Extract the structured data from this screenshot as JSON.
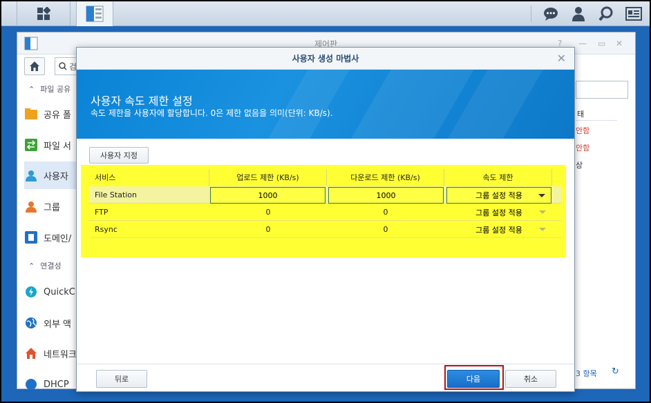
{
  "taskbar": {
    "main_menu_icon": "grid-icon",
    "control_panel_icon": "control-panel-icon",
    "right_icons": [
      "chat-icon",
      "user-icon",
      "search-icon",
      "widgets-icon"
    ]
  },
  "control_panel": {
    "title": "제어판",
    "search_text": "검",
    "sections": [
      {
        "header": "파일 공유",
        "items": [
          "공유 폴",
          "파일 서",
          "사용자",
          "그룹",
          "도메인/"
        ]
      },
      {
        "header": "연결성",
        "items": [
          "QuickC",
          "외부 액",
          "네트워크",
          "DHCP"
        ]
      }
    ],
    "right_column": {
      "header": "태",
      "rows": [
        "안함",
        "안함",
        "상"
      ]
    },
    "footer_count": "3 항목",
    "status_color": "#d63a2f"
  },
  "wizard": {
    "title": "사용자 생성 마법사",
    "heading": "사용자 속도 제한 설정",
    "subheading": "속도 제한을 사용자에 할당합니다. 0은 제한 없음을 의미(단위: KB/s).",
    "custom_button": "사용자 지정",
    "columns": [
      "서비스",
      "업로드 제한 (KB/s)",
      "다운로드 제한 (KB/s)",
      "속도 제한"
    ],
    "rows": [
      {
        "service": "File Station",
        "upload": "1000",
        "download": "1000",
        "limit": "그룹 설정 적용"
      },
      {
        "service": "FTP",
        "upload": "0",
        "download": "0",
        "limit": "그룹 설정 적용"
      },
      {
        "service": "Rsync",
        "upload": "0",
        "download": "0",
        "limit": "그룹 설정 적용"
      }
    ],
    "buttons": {
      "back": "뒤로",
      "next": "다음",
      "cancel": "취소"
    },
    "highlight_color": "#ffff33",
    "accent_color": "#1a8ae0"
  }
}
